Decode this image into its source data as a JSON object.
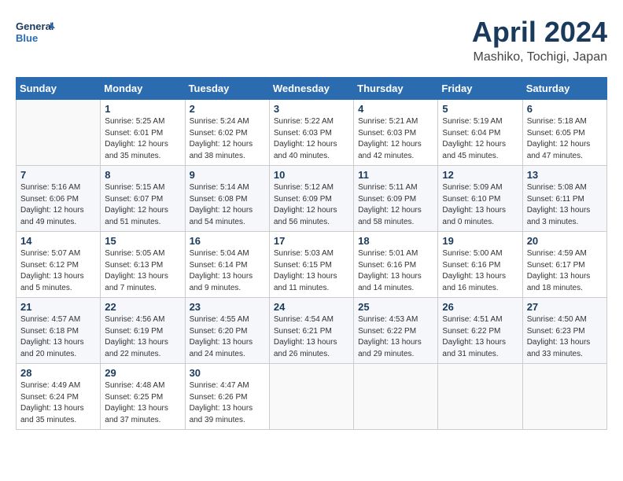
{
  "header": {
    "logo_line1": "General",
    "logo_line2": "Blue",
    "month": "April 2024",
    "location": "Mashiko, Tochigi, Japan"
  },
  "weekdays": [
    "Sunday",
    "Monday",
    "Tuesday",
    "Wednesday",
    "Thursday",
    "Friday",
    "Saturday"
  ],
  "weeks": [
    [
      {
        "day": "",
        "info": ""
      },
      {
        "day": "1",
        "info": "Sunrise: 5:25 AM\nSunset: 6:01 PM\nDaylight: 12 hours\nand 35 minutes."
      },
      {
        "day": "2",
        "info": "Sunrise: 5:24 AM\nSunset: 6:02 PM\nDaylight: 12 hours\nand 38 minutes."
      },
      {
        "day": "3",
        "info": "Sunrise: 5:22 AM\nSunset: 6:03 PM\nDaylight: 12 hours\nand 40 minutes."
      },
      {
        "day": "4",
        "info": "Sunrise: 5:21 AM\nSunset: 6:03 PM\nDaylight: 12 hours\nand 42 minutes."
      },
      {
        "day": "5",
        "info": "Sunrise: 5:19 AM\nSunset: 6:04 PM\nDaylight: 12 hours\nand 45 minutes."
      },
      {
        "day": "6",
        "info": "Sunrise: 5:18 AM\nSunset: 6:05 PM\nDaylight: 12 hours\nand 47 minutes."
      }
    ],
    [
      {
        "day": "7",
        "info": "Sunrise: 5:16 AM\nSunset: 6:06 PM\nDaylight: 12 hours\nand 49 minutes."
      },
      {
        "day": "8",
        "info": "Sunrise: 5:15 AM\nSunset: 6:07 PM\nDaylight: 12 hours\nand 51 minutes."
      },
      {
        "day": "9",
        "info": "Sunrise: 5:14 AM\nSunset: 6:08 PM\nDaylight: 12 hours\nand 54 minutes."
      },
      {
        "day": "10",
        "info": "Sunrise: 5:12 AM\nSunset: 6:09 PM\nDaylight: 12 hours\nand 56 minutes."
      },
      {
        "day": "11",
        "info": "Sunrise: 5:11 AM\nSunset: 6:09 PM\nDaylight: 12 hours\nand 58 minutes."
      },
      {
        "day": "12",
        "info": "Sunrise: 5:09 AM\nSunset: 6:10 PM\nDaylight: 13 hours\nand 0 minutes."
      },
      {
        "day": "13",
        "info": "Sunrise: 5:08 AM\nSunset: 6:11 PM\nDaylight: 13 hours\nand 3 minutes."
      }
    ],
    [
      {
        "day": "14",
        "info": "Sunrise: 5:07 AM\nSunset: 6:12 PM\nDaylight: 13 hours\nand 5 minutes."
      },
      {
        "day": "15",
        "info": "Sunrise: 5:05 AM\nSunset: 6:13 PM\nDaylight: 13 hours\nand 7 minutes."
      },
      {
        "day": "16",
        "info": "Sunrise: 5:04 AM\nSunset: 6:14 PM\nDaylight: 13 hours\nand 9 minutes."
      },
      {
        "day": "17",
        "info": "Sunrise: 5:03 AM\nSunset: 6:15 PM\nDaylight: 13 hours\nand 11 minutes."
      },
      {
        "day": "18",
        "info": "Sunrise: 5:01 AM\nSunset: 6:16 PM\nDaylight: 13 hours\nand 14 minutes."
      },
      {
        "day": "19",
        "info": "Sunrise: 5:00 AM\nSunset: 6:16 PM\nDaylight: 13 hours\nand 16 minutes."
      },
      {
        "day": "20",
        "info": "Sunrise: 4:59 AM\nSunset: 6:17 PM\nDaylight: 13 hours\nand 18 minutes."
      }
    ],
    [
      {
        "day": "21",
        "info": "Sunrise: 4:57 AM\nSunset: 6:18 PM\nDaylight: 13 hours\nand 20 minutes."
      },
      {
        "day": "22",
        "info": "Sunrise: 4:56 AM\nSunset: 6:19 PM\nDaylight: 13 hours\nand 22 minutes."
      },
      {
        "day": "23",
        "info": "Sunrise: 4:55 AM\nSunset: 6:20 PM\nDaylight: 13 hours\nand 24 minutes."
      },
      {
        "day": "24",
        "info": "Sunrise: 4:54 AM\nSunset: 6:21 PM\nDaylight: 13 hours\nand 26 minutes."
      },
      {
        "day": "25",
        "info": "Sunrise: 4:53 AM\nSunset: 6:22 PM\nDaylight: 13 hours\nand 29 minutes."
      },
      {
        "day": "26",
        "info": "Sunrise: 4:51 AM\nSunset: 6:22 PM\nDaylight: 13 hours\nand 31 minutes."
      },
      {
        "day": "27",
        "info": "Sunrise: 4:50 AM\nSunset: 6:23 PM\nDaylight: 13 hours\nand 33 minutes."
      }
    ],
    [
      {
        "day": "28",
        "info": "Sunrise: 4:49 AM\nSunset: 6:24 PM\nDaylight: 13 hours\nand 35 minutes."
      },
      {
        "day": "29",
        "info": "Sunrise: 4:48 AM\nSunset: 6:25 PM\nDaylight: 13 hours\nand 37 minutes."
      },
      {
        "day": "30",
        "info": "Sunrise: 4:47 AM\nSunset: 6:26 PM\nDaylight: 13 hours\nand 39 minutes."
      },
      {
        "day": "",
        "info": ""
      },
      {
        "day": "",
        "info": ""
      },
      {
        "day": "",
        "info": ""
      },
      {
        "day": "",
        "info": ""
      }
    ]
  ]
}
